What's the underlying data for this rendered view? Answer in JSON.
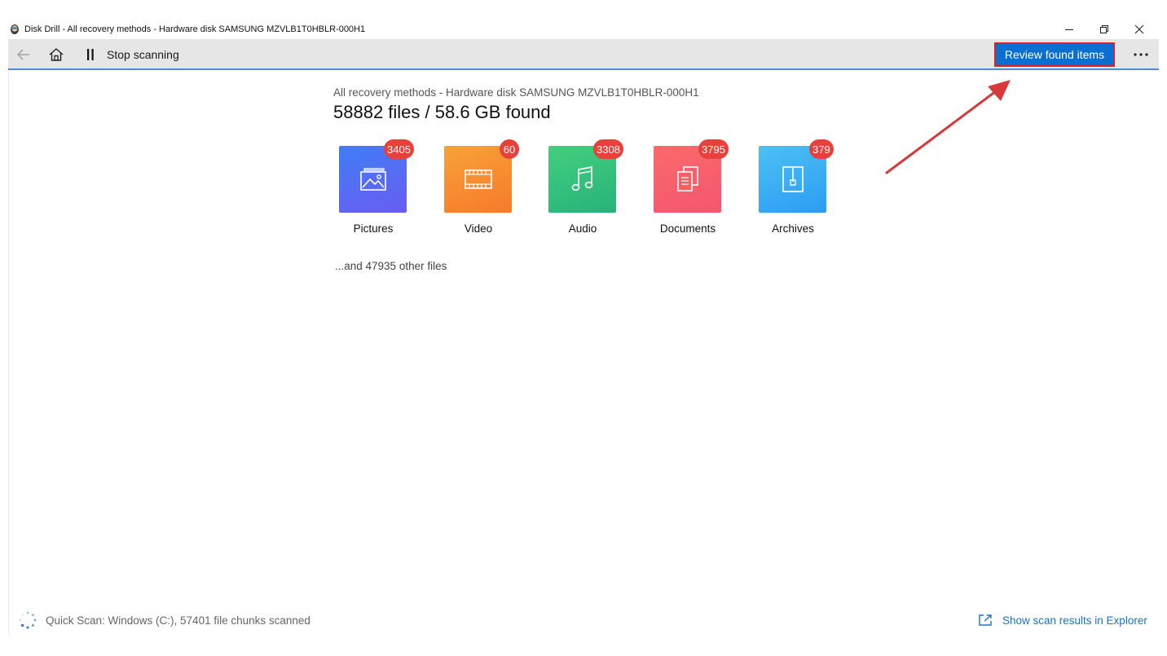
{
  "window": {
    "title": "Disk Drill - All recovery methods - Hardware disk SAMSUNG MZVLB1T0HBLR-000H1",
    "logo_icon": "disk-drill-logo-icon",
    "controls": [
      "minimize-icon",
      "restore-icon",
      "close-icon"
    ]
  },
  "toolbar": {
    "back_icon": "back-arrow-icon",
    "home_icon": "home-icon",
    "pause_icon": "pause-icon",
    "stop_label": "Stop scanning",
    "review_label": "Review found items",
    "more_icon": "more-horizontal-icon",
    "accent_color": "#0a6fd0",
    "highlight_color": "#d9232a"
  },
  "main": {
    "subtitle": "All recovery methods - Hardware disk SAMSUNG MZVLB1T0HBLR-000H1",
    "headline": "58882 files / 58.6 GB found",
    "categories": [
      {
        "label": "Pictures",
        "count": "3405",
        "icon": "picture-icon",
        "color_top": "#3f7ef7",
        "color_bottom": "#6a5cf0"
      },
      {
        "label": "Video",
        "count": "60",
        "icon": "film-icon",
        "color_top": "#f7a23a",
        "color_bottom": "#f77a2a"
      },
      {
        "label": "Audio",
        "count": "3308",
        "icon": "music-note-icon",
        "color_top": "#43cf7e",
        "color_bottom": "#27b27a"
      },
      {
        "label": "Documents",
        "count": "3795",
        "icon": "documents-icon",
        "color_top": "#fb6a6a",
        "color_bottom": "#f4566f"
      },
      {
        "label": "Archives",
        "count": "379",
        "icon": "archive-icon",
        "color_top": "#4cc0f5",
        "color_bottom": "#2c9cf2"
      }
    ],
    "other_files": "...and 47935 other files"
  },
  "footer": {
    "status_icon": "spinner-icon",
    "status_text": "Quick Scan: Windows (C:), 57401 file chunks scanned",
    "link_icon": "open-external-icon",
    "link_text": "Show scan results in Explorer"
  }
}
